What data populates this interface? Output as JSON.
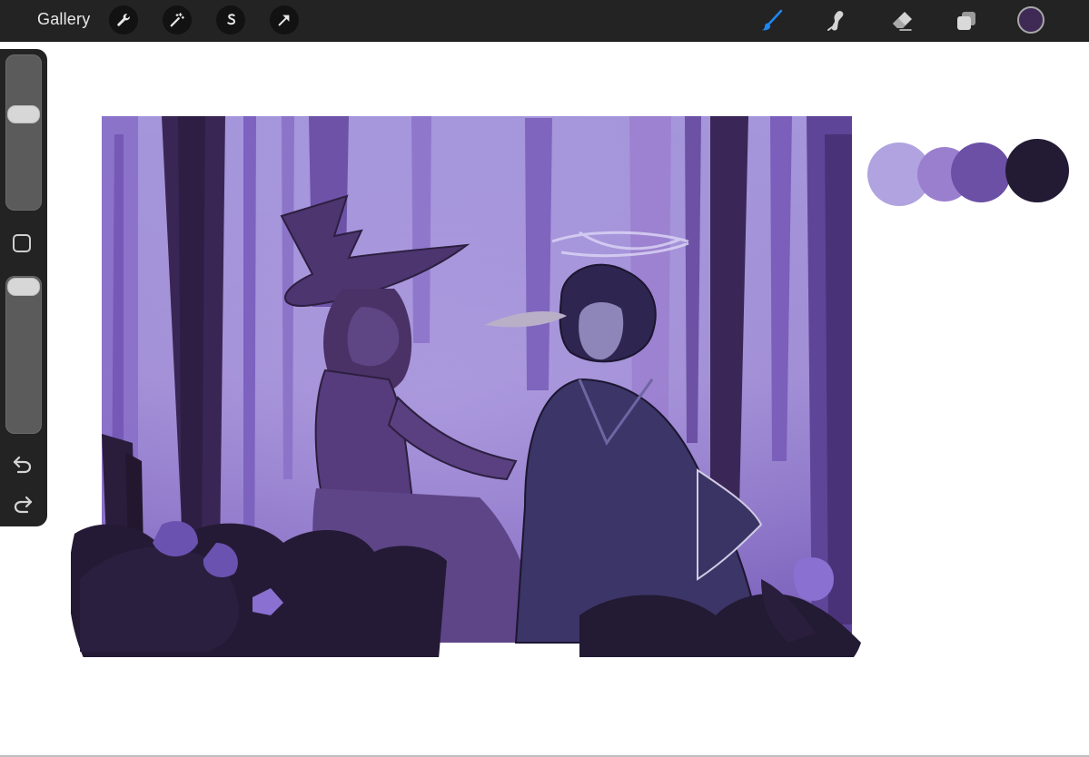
{
  "toolbar": {
    "gallery_label": "Gallery",
    "left_tools": [
      "actions-wrench-icon",
      "adjustments-magic-wand-icon",
      "selection-s-icon",
      "transform-arrow-icon"
    ],
    "right_tools": [
      "brush-icon",
      "smudge-icon",
      "eraser-icon",
      "layers-icon"
    ],
    "active_tool": "brush-icon",
    "accent_color": "#1e87f0",
    "current_color": "#3f2a55"
  },
  "sidebar": {
    "brush_size_level": 0.64,
    "opacity_level": 1.0,
    "tools": [
      "modify-square-icon",
      "undo-icon",
      "redo-icon"
    ]
  },
  "canvas": {
    "palette_colors": [
      "#b0a3e0",
      "#9b7fcf",
      "#6b50a6",
      "#231b33"
    ]
  }
}
